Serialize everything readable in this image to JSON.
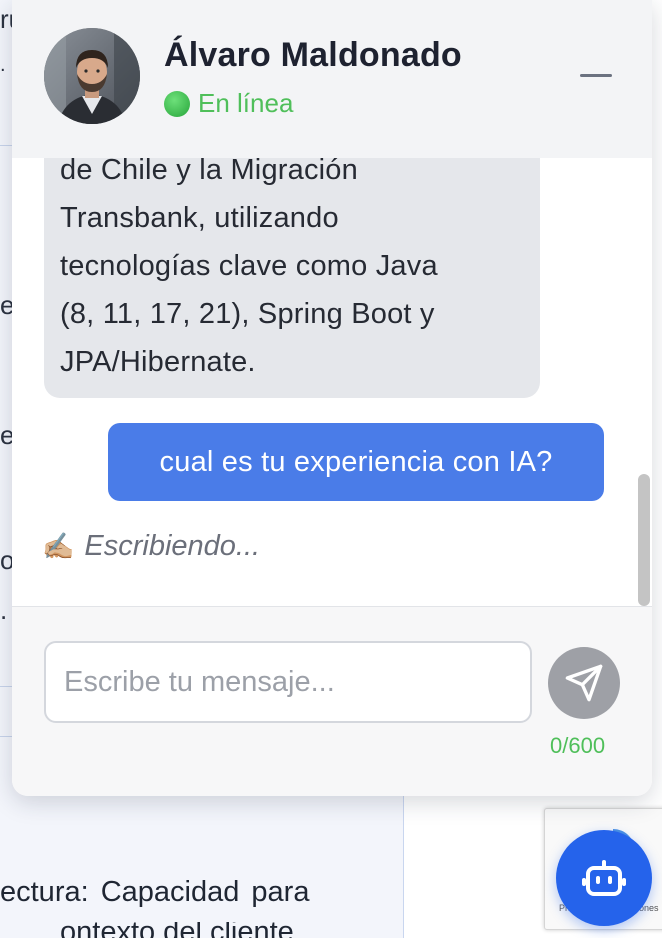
{
  "header": {
    "name": "Álvaro Maldonado",
    "status": "En línea"
  },
  "messages": {
    "bot_lines": [
      "de Chile y la Migración",
      "Transbank, utilizando",
      "tecnologías clave como Java",
      "(8, 11, 17, 21), Spring Boot y",
      "JPA/Hibernate."
    ],
    "user_message": "cual es tu experiencia con IA?",
    "typing_icon": "✍🏼",
    "typing_text": "Escribiendo..."
  },
  "composer": {
    "placeholder": "Escribe tu mensaje...",
    "value": "",
    "counter": "0/600"
  },
  "background": {
    "fragments": [
      "ru",
      "e",
      "er",
      "o"
    ],
    "bottom_text": "ectura:  Capacidad  para",
    "bottom_text2": "ontexto del cliente"
  },
  "recaptcha": {
    "text": "Privacidad - Condiciones"
  },
  "colors": {
    "status_green": "#4fbf5a",
    "user_bubble": "#4a7ce8",
    "bot_bubble": "#e5e7eb",
    "fab_blue": "#2563eb",
    "send_gray": "#9ea0a6"
  },
  "icons": {
    "minimize": "minimize-icon",
    "send": "send-icon",
    "bot": "robot-icon",
    "status": "online-dot-icon"
  }
}
